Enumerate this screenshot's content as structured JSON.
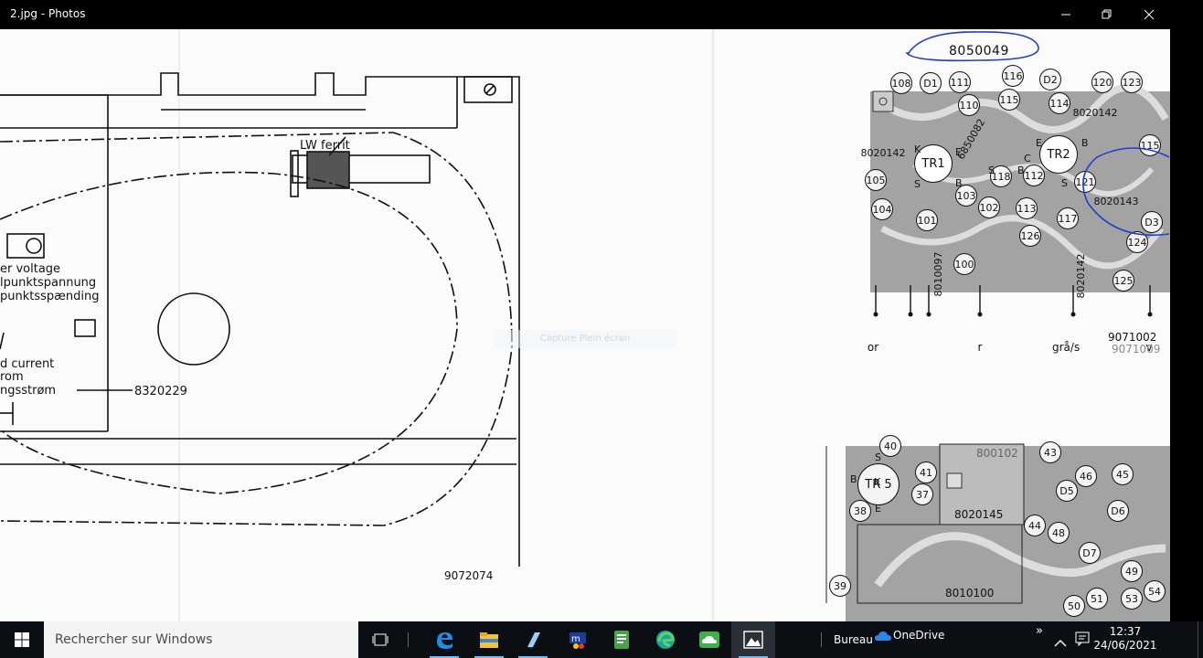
{
  "window": {
    "title": "2.jpg - Photos",
    "controls": {
      "minimize": "minimize-icon",
      "restore": "restore-icon",
      "close": "close-icon"
    }
  },
  "image": {
    "watermark": "Capture Plein écran",
    "left_drawing": {
      "labels": {
        "lw_ferrit": "LW ferrit",
        "voltage_1": "er voltage",
        "voltage_2": "lpunktspannung",
        "voltage_3": "punktsspænding",
        "current_1": "d current",
        "current_2": "rom",
        "current_3": "ngsstrøm",
        "part_number": "8320229",
        "drawing_number": "9072074"
      }
    },
    "top_board": {
      "header_number": "8050049",
      "components": [
        "108",
        "D1",
        "111",
        "116",
        "D2",
        "120",
        "123",
        "110",
        "115",
        "114",
        "8020142",
        "8020142",
        "TR1",
        "TR2",
        "115",
        "105",
        "6850082",
        "118",
        "112",
        "121",
        "8020143",
        "103",
        "102",
        "113",
        "117",
        "104",
        "101",
        "126",
        "124",
        "D3",
        "100",
        "8010097",
        "8020142",
        "125"
      ],
      "pins": [
        "or",
        "r",
        "grå/s",
        "v"
      ],
      "pin_letters": [
        "K",
        "E",
        "S",
        "B",
        "E",
        "B",
        "C",
        "S",
        "S",
        "B"
      ],
      "footer_1": "9071002",
      "footer_2": "9071009"
    },
    "bottom_board": {
      "components": [
        "40",
        "41",
        "TR 5",
        "37",
        "38",
        "39",
        "43",
        "46",
        "45",
        "D5",
        "D6",
        "44",
        "48",
        "D7",
        "49",
        "50",
        "51",
        "53",
        "54"
      ],
      "labels": [
        "800102",
        "8020145",
        "8010100"
      ],
      "pin_letters": [
        "S",
        "B",
        "K",
        "E"
      ]
    }
  },
  "taskbar": {
    "search_placeholder": "Rechercher sur Windows",
    "apps": [
      "task-view-icon",
      "edge-legacy-icon",
      "file-explorer-icon",
      "notepad-icon",
      "mediaplayer-icon",
      "notes-icon",
      "edge-icon",
      "cloud-app-icon",
      "photos-icon"
    ],
    "desktop_label": "Bureau",
    "onedrive_label": "OneDrive",
    "overflow": "»",
    "time": "12:37",
    "date": "24/06/2021"
  },
  "colors": {
    "titlebar_bg": "#000000",
    "taskbar_bg": "#0b0f14",
    "annotation_blue": "#1f3fd1",
    "pcb_gray": "#9a9a9a",
    "accent": "#76b9ed"
  }
}
